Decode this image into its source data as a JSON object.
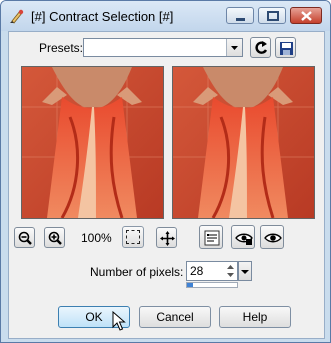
{
  "window": {
    "title": "[#] Contract Selection [#]"
  },
  "presets": {
    "label": "Presets:",
    "value": ""
  },
  "zoom": {
    "value": "100%"
  },
  "pixels": {
    "label": "Number of pixels:",
    "value": "28",
    "slider_fraction": 0.12
  },
  "buttons": {
    "ok": "OK",
    "cancel": "Cancel",
    "help": "Help"
  },
  "colors": {
    "accent": "#3f82d4",
    "preview_bg": "#c7482e",
    "dress": "#e8422a"
  },
  "icons": [
    "app-icon",
    "minimize-icon",
    "maximize-icon",
    "close-icon",
    "dropdown-arrow-icon",
    "reset-arrow-icon",
    "save-preset-icon",
    "zoom-out-icon",
    "zoom-in-icon",
    "marquee-icon",
    "pan-icon",
    "proof-icon",
    "lock-eye-icon",
    "eye-icon"
  ]
}
